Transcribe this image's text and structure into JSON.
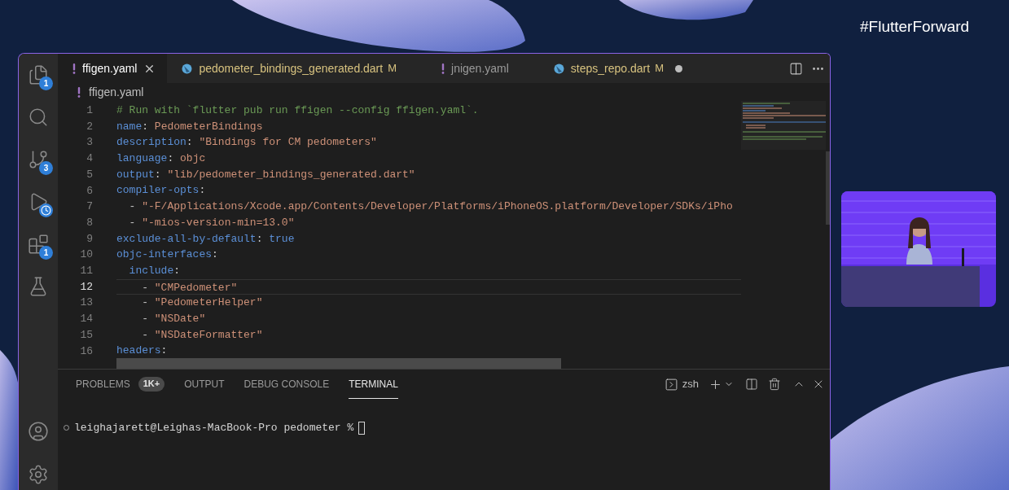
{
  "activity_bar": {
    "top": [
      {
        "kind": "explorer",
        "badge": "1"
      },
      {
        "kind": "search"
      },
      {
        "kind": "source_control",
        "badge": "3"
      },
      {
        "kind": "run_debug"
      },
      {
        "kind": "extensions",
        "badge": "1"
      },
      {
        "kind": "testing"
      }
    ],
    "bottom": [
      {
        "kind": "accounts"
      },
      {
        "kind": "settings"
      }
    ]
  },
  "tabs": [
    {
      "kind": "yaml",
      "label": "ffigen.yaml",
      "selected": true,
      "dirty": false
    },
    {
      "kind": "dart",
      "label": "pedometer_bindings_generated.dart",
      "badge": "M",
      "selected": false,
      "dirty": false
    },
    {
      "kind": "yaml",
      "label": "jnigen.yaml",
      "selected": false,
      "dirty": false
    },
    {
      "kind": "dart",
      "label": "steps_repo.dart",
      "badge": "M",
      "selected": false,
      "dirty": true
    }
  ],
  "breadcrumb": {
    "kind": "yaml",
    "label": "ffigen.yaml"
  },
  "editor": {
    "lines": [
      {
        "number": "1",
        "current": false,
        "tokens": [
          {
            "kind": "comment",
            "text": "# Run with `flutter pub run ffigen --config ffigen.yaml`."
          }
        ]
      },
      {
        "number": "2",
        "current": false,
        "tokens": [
          {
            "kind": "key",
            "text": "name"
          },
          {
            "kind": "punct",
            "text": ": "
          },
          {
            "kind": "string",
            "text": "PedometerBindings"
          }
        ]
      },
      {
        "number": "3",
        "current": false,
        "tokens": [
          {
            "kind": "key",
            "text": "description"
          },
          {
            "kind": "punct",
            "text": ": "
          },
          {
            "kind": "string",
            "text": "\"Bindings for CM pedometers\""
          }
        ]
      },
      {
        "number": "4",
        "current": false,
        "tokens": [
          {
            "kind": "key",
            "text": "language"
          },
          {
            "kind": "punct",
            "text": ": "
          },
          {
            "kind": "string",
            "text": "objc"
          }
        ]
      },
      {
        "number": "5",
        "current": false,
        "tokens": [
          {
            "kind": "key",
            "text": "output"
          },
          {
            "kind": "punct",
            "text": ": "
          },
          {
            "kind": "string",
            "text": "\"lib/pedometer_bindings_generated.dart\""
          }
        ]
      },
      {
        "number": "6",
        "current": false,
        "tokens": [
          {
            "kind": "key",
            "text": "compiler-opts"
          },
          {
            "kind": "punct",
            "text": ":"
          }
        ]
      },
      {
        "number": "7",
        "current": false,
        "tokens": [
          {
            "kind": "punct",
            "text": "  - "
          },
          {
            "kind": "string",
            "text": "\"-F/Applications/Xcode.app/Contents/Developer/Platforms/iPhoneOS.platform/Developer/SDKs/iPho"
          }
        ]
      },
      {
        "number": "8",
        "current": false,
        "tokens": [
          {
            "kind": "punct",
            "text": "  - "
          },
          {
            "kind": "string",
            "text": "\"-mios-version-min=13.0\""
          }
        ]
      },
      {
        "number": "9",
        "current": false,
        "tokens": [
          {
            "kind": "key",
            "text": "exclude-all-by-default"
          },
          {
            "kind": "punct",
            "text": ": "
          },
          {
            "kind": "bool",
            "text": "true"
          }
        ]
      },
      {
        "number": "10",
        "current": false,
        "tokens": [
          {
            "kind": "key",
            "text": "objc-interfaces"
          },
          {
            "kind": "punct",
            "text": ":"
          }
        ]
      },
      {
        "number": "11",
        "current": false,
        "tokens": [
          {
            "kind": "key",
            "text": "  include"
          },
          {
            "kind": "punct",
            "text": ":"
          }
        ]
      },
      {
        "number": "12",
        "current": true,
        "tokens": [
          {
            "kind": "punct",
            "text": "    - "
          },
          {
            "kind": "string",
            "text": "\"CMPedometer\""
          }
        ]
      },
      {
        "number": "13",
        "current": false,
        "tokens": [
          {
            "kind": "punct",
            "text": "    - "
          },
          {
            "kind": "string",
            "text": "\"PedometerHelper\""
          }
        ]
      },
      {
        "number": "14",
        "current": false,
        "tokens": [
          {
            "kind": "punct",
            "text": "    - "
          },
          {
            "kind": "string",
            "text": "\"NSDate\""
          }
        ]
      },
      {
        "number": "15",
        "current": false,
        "tokens": [
          {
            "kind": "punct",
            "text": "    - "
          },
          {
            "kind": "string",
            "text": "\"NSDateFormatter\""
          }
        ]
      },
      {
        "number": "16",
        "current": false,
        "tokens": [
          {
            "kind": "key",
            "text": "headers"
          },
          {
            "kind": "punct",
            "text": ":"
          }
        ]
      }
    ]
  },
  "panel": {
    "tabs": [
      {
        "label": "PROBLEMS",
        "badge": "1K+",
        "selected": false
      },
      {
        "label": "OUTPUT",
        "selected": false
      },
      {
        "label": "DEBUG CONSOLE",
        "selected": false
      },
      {
        "label": "TERMINAL",
        "selected": true
      }
    ],
    "shell": "zsh",
    "terminal": {
      "prompt": "leighajarett@Leighas-MacBook-Pro pedometer %"
    }
  },
  "hashtag": "#FlutterForward"
}
